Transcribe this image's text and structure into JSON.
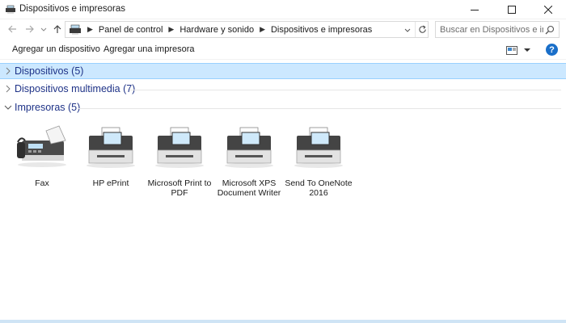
{
  "window": {
    "title": "Dispositivos e impresoras"
  },
  "address": {
    "crumbs": [
      "Panel de control",
      "Hardware y sonido",
      "Dispositivos e impresoras"
    ],
    "search_placeholder": "Buscar en Dispositivos e impr..."
  },
  "commands": {
    "add_device": "Agregar un dispositivo",
    "add_printer": "Agregar una impresora",
    "help": "?"
  },
  "groups": [
    {
      "label": "Dispositivos (5)",
      "expanded": false,
      "selected": true
    },
    {
      "label": "Dispositivos multimedia (7)",
      "expanded": false,
      "selected": false
    },
    {
      "label": "Impresoras (5)",
      "expanded": true,
      "selected": false
    }
  ],
  "printers": [
    {
      "name": "Fax",
      "icon": "fax-icon"
    },
    {
      "name": "HP ePrint",
      "icon": "printer-icon"
    },
    {
      "name": "Microsoft Print to PDF",
      "icon": "printer-icon"
    },
    {
      "name": "Microsoft XPS Document Writer",
      "icon": "printer-icon"
    },
    {
      "name": "Send To OneNote 2016",
      "icon": "printer-icon"
    }
  ],
  "colors": {
    "group_header_text": "#1e3287",
    "selected_group_bg": "#cce8ff",
    "help_blue": "#1a6fc9"
  }
}
